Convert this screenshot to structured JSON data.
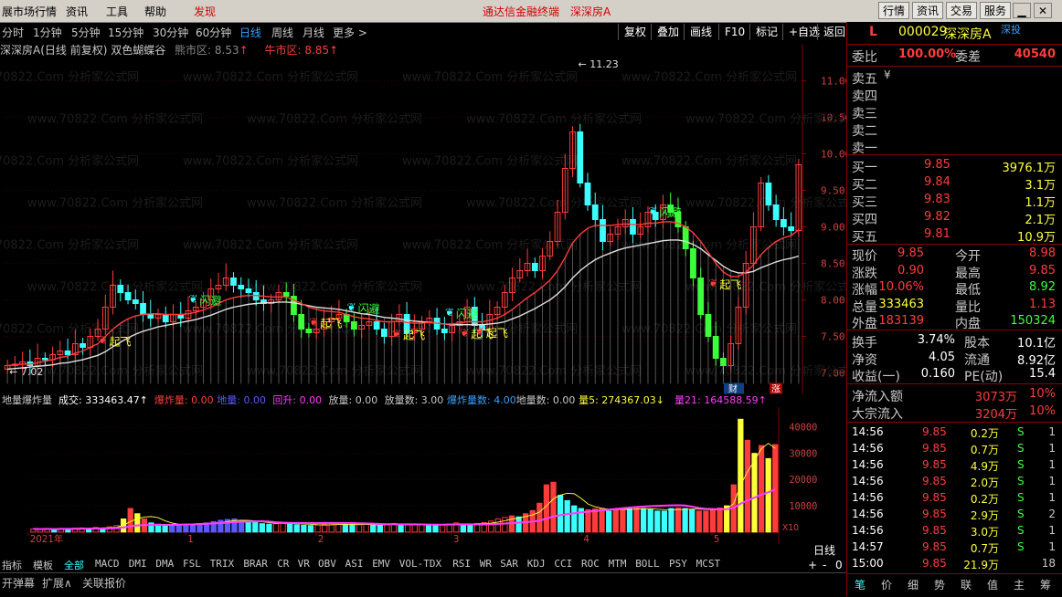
{
  "menu": {
    "items": [
      "展市场行情",
      "资讯",
      "工具",
      "帮助",
      "发现"
    ],
    "center_title": "通达信金融终端",
    "center_stock": "深深房A",
    "right_buttons": [
      "行情",
      "资讯",
      "交易",
      "服务"
    ]
  },
  "periods": [
    "分时",
    "1分钟",
    "5分钟",
    "15分钟",
    "30分钟",
    "60分钟",
    "日线",
    "周线",
    "月线",
    "更多 >"
  ],
  "active_period": "日线",
  "toolbar": [
    "复权",
    "叠加",
    "画线",
    "F10",
    "标记",
    "+自选",
    "返回"
  ],
  "chart_title": {
    "name": "深深房A(日线 前复权) 双色蝴蝶谷",
    "bear_label": "熊市区: 8.53",
    "bull_label": "牛市区: 8.85"
  },
  "watermark": "www.70822.Com 分析家公式网",
  "chart_data": [
    {
      "type": "candlestick",
      "title": "深深房A(日线 前复权) 双色蝴蝶谷",
      "ylim": [
        6.85,
        11.35
      ],
      "yticks": [
        7.0,
        7.5,
        8.0,
        8.5,
        9.0,
        9.5,
        10.0,
        10.5,
        11.0
      ],
      "high_marker": "11.23",
      "low_marker": "7.02",
      "labels_qifei": "起飞",
      "labels_shanbi": "闪避",
      "badge_caibao": "财",
      "badge_zhang": "涨",
      "series": [
        {
          "name": "candles",
          "values": [
            7.1,
            7.12,
            7.15,
            7.1,
            7.2,
            7.18,
            7.25,
            7.3,
            7.25,
            7.4,
            7.35,
            7.5,
            7.6,
            7.9,
            8.2,
            8.1,
            8.0,
            7.95,
            7.8,
            7.75,
            7.8,
            7.7,
            7.8,
            7.75,
            7.85,
            7.9,
            8.0,
            8.15,
            8.2,
            8.3,
            8.2,
            8.15,
            8.1,
            8.0,
            7.95,
            8.0,
            8.1,
            8.05,
            7.8,
            7.6,
            7.55,
            7.6,
            7.7,
            7.75,
            7.8,
            7.7,
            7.6,
            7.65,
            7.7,
            7.6,
            7.5,
            7.7,
            7.8,
            7.55,
            7.6,
            7.7,
            7.75,
            7.6,
            7.55,
            7.65,
            7.7,
            7.9,
            7.65,
            7.6,
            7.8,
            7.9,
            8.1,
            8.3,
            8.4,
            8.5,
            8.4,
            8.6,
            8.8,
            9.2,
            9.8,
            10.3,
            9.6,
            9.3,
            9.1,
            8.8,
            8.9,
            9.0,
            9.1,
            8.9,
            9.0,
            9.2,
            9.1,
            9.3,
            9.2,
            9.0,
            8.7,
            8.3,
            7.8,
            7.5,
            7.2,
            7.1,
            7.4,
            7.9,
            8.5,
            9.0,
            9.6,
            9.3,
            9.1,
            9.0,
            8.95,
            9.85
          ]
        },
        {
          "name": "ma_red",
          "values": [
            7.1,
            7.11,
            7.12,
            7.12,
            7.14,
            7.16,
            7.18,
            7.21,
            7.23,
            7.27,
            7.3,
            7.35,
            7.4,
            7.5,
            7.6,
            7.68,
            7.74,
            7.78,
            7.8,
            7.81,
            7.81,
            7.8,
            7.8,
            7.8,
            7.81,
            7.83,
            7.86,
            7.9,
            7.95,
            8.0,
            8.03,
            8.05,
            8.06,
            8.06,
            8.05,
            8.04,
            8.04,
            8.04,
            8.0,
            7.95,
            7.9,
            7.87,
            7.85,
            7.84,
            7.83,
            7.8,
            7.77,
            7.75,
            7.74,
            7.72,
            7.7,
            7.7,
            7.71,
            7.69,
            7.68,
            7.68,
            7.69,
            7.68,
            7.67,
            7.67,
            7.68,
            7.7,
            7.7,
            7.7,
            7.72,
            7.75,
            7.8,
            7.87,
            7.95,
            8.03,
            8.1,
            8.18,
            8.27,
            8.4,
            8.58,
            8.78,
            8.9,
            8.98,
            9.02,
            9.02,
            9.02,
            9.03,
            9.04,
            9.03,
            9.03,
            9.05,
            9.05,
            9.07,
            9.07,
            9.05,
            9.0,
            8.92,
            8.8,
            8.65,
            8.5,
            8.38,
            8.32,
            8.32,
            8.38,
            8.48,
            8.62,
            8.72,
            8.8,
            8.85,
            8.88,
            8.96
          ]
        },
        {
          "name": "ma_white",
          "values": [
            7.05,
            7.06,
            7.07,
            7.08,
            7.09,
            7.1,
            7.11,
            7.13,
            7.14,
            7.16,
            7.18,
            7.21,
            7.24,
            7.29,
            7.36,
            7.42,
            7.48,
            7.53,
            7.57,
            7.6,
            7.63,
            7.65,
            7.67,
            7.69,
            7.71,
            7.73,
            7.76,
            7.79,
            7.83,
            7.87,
            7.9,
            7.92,
            7.94,
            7.95,
            7.96,
            7.96,
            7.97,
            7.97,
            7.96,
            7.94,
            7.92,
            7.9,
            7.89,
            7.88,
            7.87,
            7.85,
            7.83,
            7.81,
            7.8,
            7.78,
            7.76,
            7.75,
            7.74,
            7.72,
            7.71,
            7.7,
            7.69,
            7.68,
            7.67,
            7.66,
            7.66,
            7.66,
            7.66,
            7.66,
            7.67,
            7.68,
            7.7,
            7.74,
            7.78,
            7.83,
            7.88,
            7.94,
            8.0,
            8.08,
            8.18,
            8.3,
            8.4,
            8.48,
            8.55,
            8.6,
            8.64,
            8.68,
            8.71,
            8.73,
            8.75,
            8.77,
            8.79,
            8.81,
            8.82,
            8.82,
            8.8,
            8.76,
            8.7,
            8.62,
            8.54,
            8.46,
            8.4,
            8.37,
            8.37,
            8.39,
            8.44,
            8.48,
            8.52,
            8.55,
            8.57,
            8.6
          ]
        }
      ]
    },
    {
      "type": "bar",
      "title": "地量爆炸量",
      "ylim": [
        0,
        45000
      ],
      "yticks": [
        10000,
        20000,
        30000,
        40000
      ],
      "unit_label": "X10",
      "x_labels": [
        "2021年",
        "1",
        "2",
        "3",
        "4",
        "5"
      ],
      "series": [
        {
          "name": "volume",
          "values": [
            1200,
            1100,
            1300,
            1000,
            1400,
            1200,
            1500,
            1600,
            1400,
            1800,
            1500,
            2000,
            2500,
            5000,
            9000,
            7000,
            5000,
            3500,
            3000,
            2800,
            3000,
            2600,
            3000,
            2800,
            3200,
            3500,
            4000,
            4500,
            4800,
            5000,
            4200,
            3800,
            3600,
            3200,
            3000,
            3200,
            3600,
            3400,
            2800,
            2600,
            2500,
            2700,
            3000,
            3100,
            3200,
            2900,
            2700,
            2800,
            3000,
            2700,
            2500,
            3000,
            3300,
            2600,
            2700,
            3000,
            3100,
            2700,
            2600,
            2900,
            3100,
            3500,
            3000,
            2900,
            3300,
            3600,
            4200,
            5000,
            5600,
            6200,
            5800,
            7000,
            8200,
            11000,
            18000,
            19000,
            14000,
            12000,
            10000,
            9000,
            8500,
            8800,
            9000,
            8000,
            8500,
            9000,
            8800,
            9200,
            9000,
            8600,
            8000,
            8000,
            9000,
            9200,
            9000,
            8600,
            8000,
            8000,
            9000,
            9200,
            10000,
            18000,
            43000,
            35000,
            30000,
            33000,
            28000,
            33346
          ]
        }
      ]
    }
  ],
  "vol_header": {
    "name": "地量爆炸量",
    "items": [
      {
        "label": "成交:",
        "value": "333463.47↑",
        "color": "#ffffff"
      },
      {
        "label": "爆炸量:",
        "value": "0.00",
        "color": "#ff3c3c"
      },
      {
        "label": "地量:",
        "value": "0.00",
        "color": "#5a5aff"
      },
      {
        "label": "回升:",
        "value": "0.00",
        "color": "#ff3cff"
      },
      {
        "label": "放量:",
        "value": "0.00",
        "color": "#c8c8c8"
      },
      {
        "label": "放量数:",
        "value": "3.00",
        "color": "#c8c8c8"
      },
      {
        "label": "爆炸量数:",
        "value": "4.00",
        "color": "#35a0ff"
      },
      {
        "label": "地量数:",
        "value": "0.00",
        "color": "#c8c8c8"
      },
      {
        "label": "量5:",
        "value": "274367.03↓",
        "color": "#ffff3c"
      },
      {
        "label": "量21:",
        "value": "164588.59↑",
        "color": "#ff3cff"
      }
    ]
  },
  "indicators": [
    "指标",
    "模板",
    "全部",
    "MACD",
    "DMI",
    "DMA",
    "FSL",
    "TRIX",
    "BRAR",
    "CR",
    "VR",
    "OBV",
    "ASI",
    "EMV",
    "VOL-TDX",
    "RSI",
    "WR",
    "SAR",
    "KDJ",
    "CCI",
    "ROC",
    "MTM",
    "BOLL",
    "PSY",
    "MCST"
  ],
  "bottom_tabs": [
    "开弹幕",
    "扩展∧",
    "关联报价"
  ],
  "bottom_right": [
    "日线",
    "+",
    "-",
    "0"
  ],
  "quote": {
    "flag": "L",
    "code": "000029",
    "name": "深深房A",
    "tag": "深投",
    "weibi_label": "委比",
    "weibi": "100.00%",
    "weicha_label": "委差",
    "weicha": "40540",
    "sells": [
      {
        "label": "卖五",
        "price": "",
        "vol": ""
      },
      {
        "label": "卖四",
        "price": "",
        "vol": ""
      },
      {
        "label": "卖三",
        "price": "",
        "vol": ""
      },
      {
        "label": "卖二",
        "price": "",
        "vol": ""
      },
      {
        "label": "卖一",
        "price": "",
        "vol": ""
      }
    ],
    "buys": [
      {
        "label": "买一",
        "price": "9.85",
        "vol": "3976.1万"
      },
      {
        "label": "买二",
        "price": "9.84",
        "vol": "3.1万"
      },
      {
        "label": "买三",
        "price": "9.83",
        "vol": "1.1万"
      },
      {
        "label": "买四",
        "price": "9.82",
        "vol": "2.1万"
      },
      {
        "label": "买五",
        "price": "9.81",
        "vol": "10.9万"
      }
    ],
    "stats": [
      {
        "l1": "现价",
        "v1": "9.85",
        "c1": "#ff3c3c",
        "l2": "今开",
        "v2": "8.98",
        "c2": "#ff3c3c"
      },
      {
        "l1": "涨跌",
        "v1": "0.90",
        "c1": "#ff3c3c",
        "l2": "最高",
        "v2": "9.85",
        "c2": "#ff3c3c"
      },
      {
        "l1": "涨幅",
        "v1": "10.06%",
        "c1": "#ff3c3c",
        "l2": "最低",
        "v2": "8.92",
        "c2": "#3cff3c"
      },
      {
        "l1": "总量",
        "v1": "333463",
        "c1": "#ffff3c",
        "l2": "量比",
        "v2": "1.13",
        "c2": "#ff3c3c"
      },
      {
        "l1": "外盘",
        "v1": "183139",
        "c1": "#ff3c3c",
        "l2": "内盘",
        "v2": "150324",
        "c2": "#3cff3c"
      }
    ],
    "stats2": [
      {
        "l1": "换手",
        "v1": "3.74%",
        "l2": "股本",
        "v2": "10.1亿"
      },
      {
        "l1": "净资",
        "v1": "4.05",
        "l2": "流通",
        "v2": "8.92亿"
      },
      {
        "l1": "收益(一)",
        "v1": "0.160",
        "l2": "PE(动)",
        "v2": "15.4"
      }
    ],
    "flows": [
      {
        "label": "净流入额",
        "value": "3073万",
        "pct": "10%"
      },
      {
        "label": "大宗流入",
        "value": "3204万",
        "pct": "10%"
      }
    ],
    "ticks": [
      {
        "t": "14:56",
        "p": "9.85",
        "v": "0.2万",
        "s": "S",
        "n": "1"
      },
      {
        "t": "14:56",
        "p": "9.85",
        "v": "0.7万",
        "s": "S",
        "n": "1"
      },
      {
        "t": "14:56",
        "p": "9.85",
        "v": "4.9万",
        "s": "S",
        "n": "1"
      },
      {
        "t": "14:56",
        "p": "9.85",
        "v": "2.0万",
        "s": "S",
        "n": "1"
      },
      {
        "t": "14:56",
        "p": "9.85",
        "v": "0.2万",
        "s": "S",
        "n": "1"
      },
      {
        "t": "14:56",
        "p": "9.85",
        "v": "2.9万",
        "s": "S",
        "n": "2"
      },
      {
        "t": "14:56",
        "p": "9.85",
        "v": "3.0万",
        "s": "S",
        "n": "1"
      },
      {
        "t": "14:57",
        "p": "9.85",
        "v": "0.7万",
        "s": "S",
        "n": "1"
      },
      {
        "t": "15:00",
        "p": "9.85",
        "v": "21.9万",
        "s": "",
        "n": "18"
      }
    ],
    "tabs": [
      "笔",
      "价",
      "细",
      "势",
      "联",
      "值",
      "主",
      "筹"
    ]
  }
}
